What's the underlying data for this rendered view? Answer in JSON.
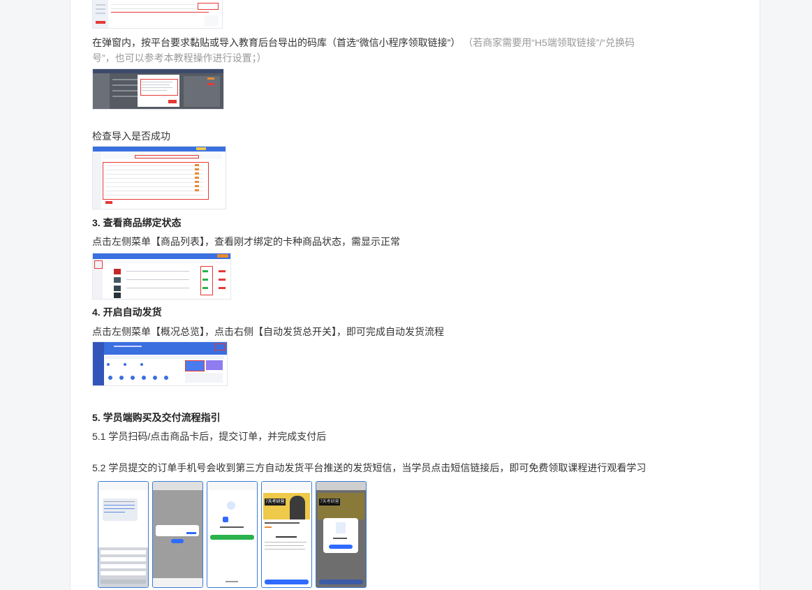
{
  "paragraph_popup": {
    "main": "在弹窗内，按平台要求黏贴或导入教育后台导出的码库（首选“微信小程序领取链接”）",
    "note_line1": "（若商家需要用“H5端领取链接”/“兑换码",
    "note_line2": "号”，也可以参考本教程操作进行设置；）"
  },
  "check_import": "检查导入是否成功",
  "section3": {
    "heading": "3. 查看商品绑定状态",
    "body": "点击左侧菜单【商品列表】，查看刚才绑定的卡种商品状态，需显示正常"
  },
  "section4": {
    "heading": "4. 开启自动发货",
    "body": "点击左侧菜单【概况总览】，点击右侧【自动发货总开关】，即可完成自动发货流程"
  },
  "section5": {
    "heading": "5. 学员端购买及交付流程指引",
    "step1": "5.1 学员扫码/点击商品卡后，提交订单，并完成支付后",
    "step2": "5.2 学员提交的订单手机号会收到第三方自动发货平台推送的发货短信，当学员点击短信链接后，即可免费领取课程进行观看学习"
  },
  "phone_labels": {
    "p4_banner": "7天考研营",
    "p5_banner": "7天考研营"
  },
  "colors": {
    "accent": "#3a6fe0",
    "highlight": "#e53935",
    "button_green": "#2bb24c",
    "button_blue": "#2f6bff"
  }
}
